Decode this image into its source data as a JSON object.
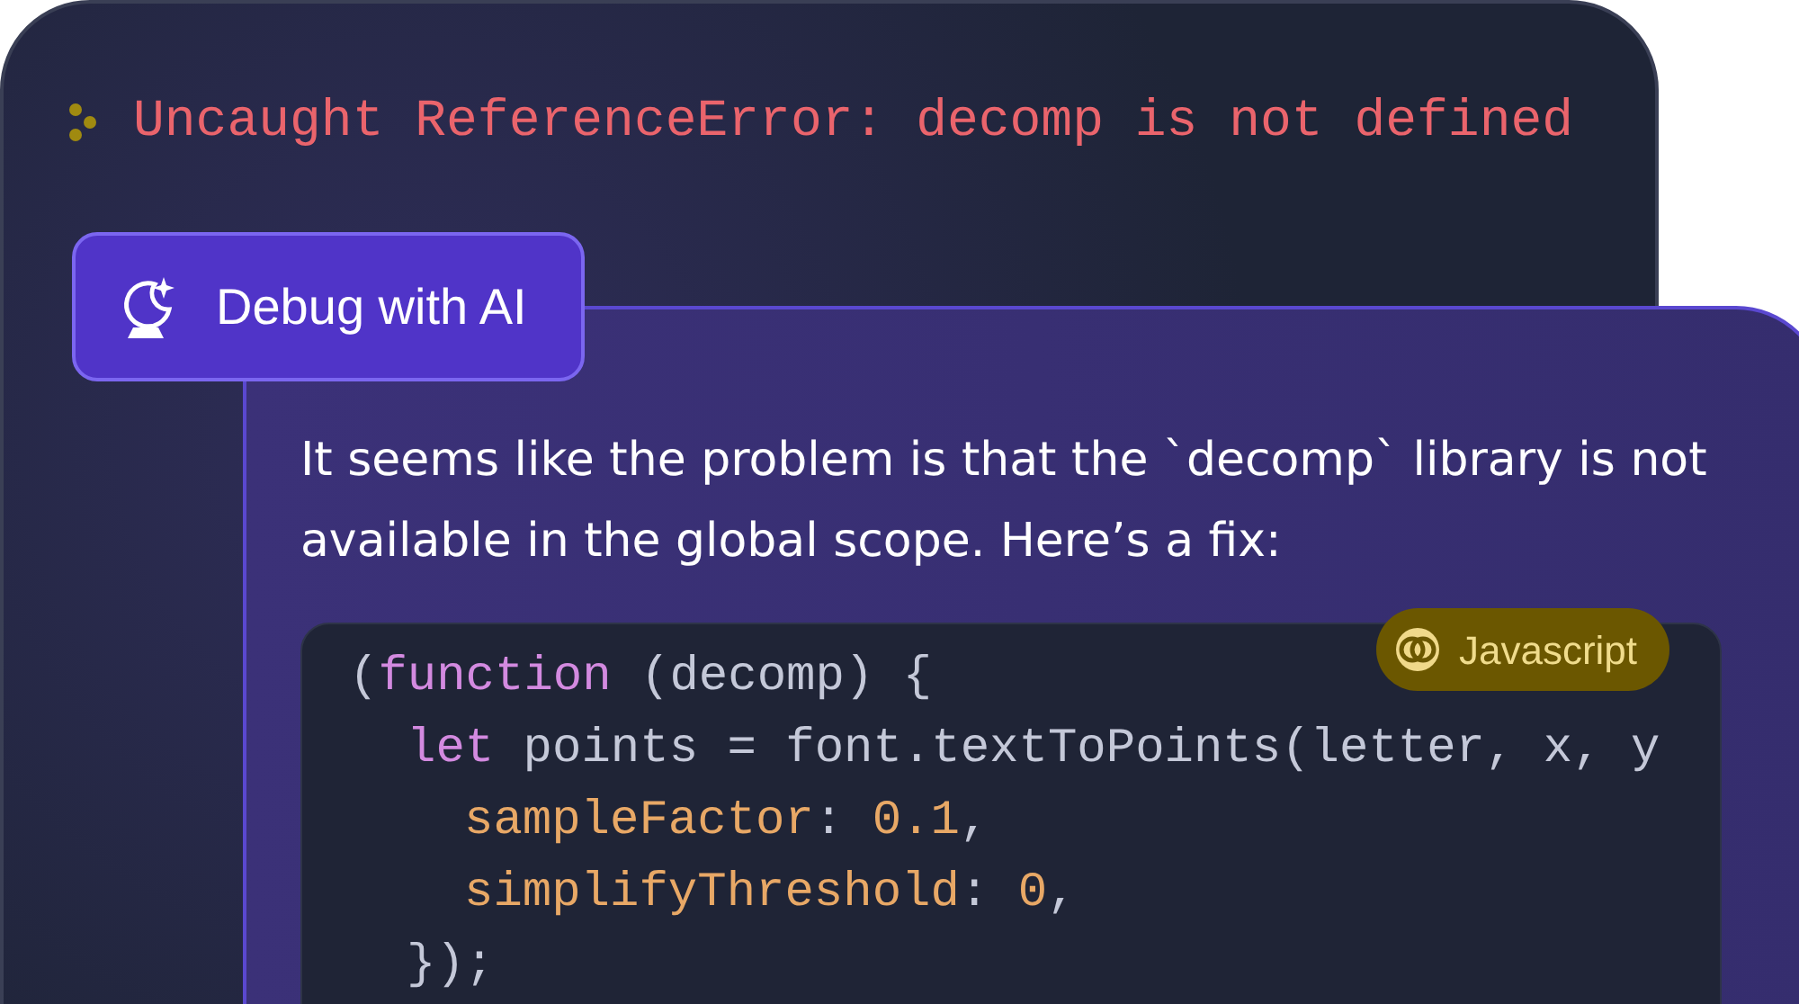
{
  "error": {
    "message": "Uncaught ReferenceError: decomp is not defined"
  },
  "debug_button": {
    "label": "Debug with AI"
  },
  "answer": {
    "text": "It seems like the problem is that the `decomp` library is not available in the global scope. Here’s a fix:",
    "code": {
      "language": "Javascript",
      "lines": [
        {
          "tokens": [
            {
              "kind": "plain",
              "text": "("
            },
            {
              "kind": "keyword",
              "text": "function"
            },
            {
              "kind": "plain",
              "text": " (decomp) {"
            }
          ],
          "children": [
            {
              "tokens": [
                {
                  "kind": "keyword",
                  "text": "let"
                },
                {
                  "kind": "plain",
                  "text": " points = font.textToPoints(letter, x, y"
                }
              ],
              "children": [
                {
                  "tokens": [
                    {
                      "kind": "property",
                      "text": "sampleFactor"
                    },
                    {
                      "kind": "plain",
                      "text": ": "
                    },
                    {
                      "kind": "number",
                      "text": "0.1"
                    },
                    {
                      "kind": "plain",
                      "text": ","
                    }
                  ]
                },
                {
                  "tokens": [
                    {
                      "kind": "property",
                      "text": "simplifyThreshold"
                    },
                    {
                      "kind": "plain",
                      "text": ": "
                    },
                    {
                      "kind": "number",
                      "text": "0"
                    },
                    {
                      "kind": "plain",
                      "text": ","
                    }
                  ]
                }
              ]
            },
            {
              "tokens": [
                {
                  "kind": "plain",
                  "text": "});"
                }
              ]
            }
          ]
        }
      ]
    }
  }
}
